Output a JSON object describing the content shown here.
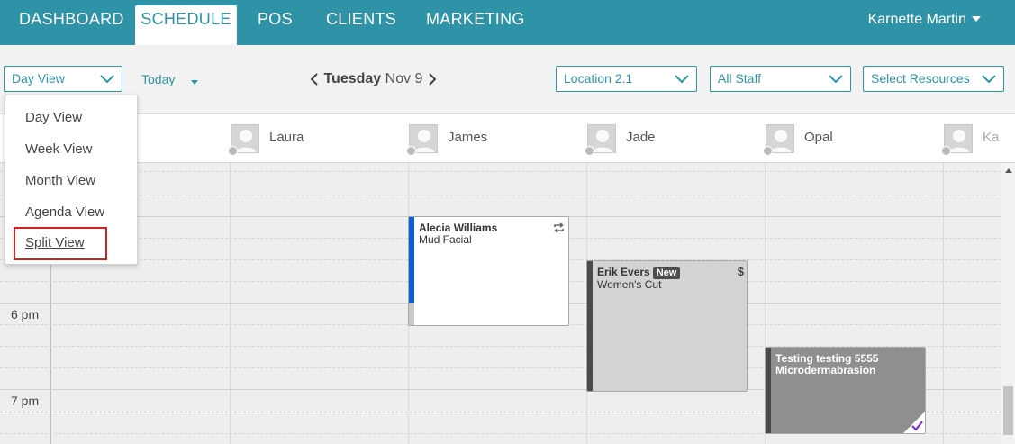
{
  "nav": {
    "items": [
      "DASHBOARD",
      "SCHEDULE",
      "POS",
      "CLIENTS",
      "MARKETING"
    ],
    "active": "SCHEDULE",
    "user": "Karnette Martin"
  },
  "toolbar": {
    "view_select": "Day View",
    "today": "Today",
    "date_day": "Tuesday",
    "date_rest": "Nov 9",
    "location": "Location 2.1",
    "staff": "All Staff",
    "resources": "Select Resources"
  },
  "view_menu": {
    "items": [
      "Day View",
      "Week View",
      "Month View",
      "Agenda View",
      "Split View"
    ]
  },
  "staff": [
    "Laura",
    "James",
    "Jade",
    "Opal",
    "Ka"
  ],
  "time_labels": [
    "6 pm",
    "7 pm"
  ],
  "appointments": [
    {
      "client": "Alecia Williams",
      "service": "Mud Facial",
      "icon": "repeat-icon",
      "color": "#0b5ed7"
    },
    {
      "client": "Erik Evers",
      "badge": "New",
      "service": "Women's Cut",
      "icon": "dollar-icon",
      "color": "#4a4a4a"
    },
    {
      "client": "Testing testing 5555",
      "service": "Microdermabrasion",
      "icon": "checkmark-icon",
      "color": "#4a4a4a"
    }
  ],
  "colors": {
    "nav_bg": "#2e93a6",
    "accent": "#2e93a6",
    "highlight_border": "#d42020",
    "check": "#7b2fd4"
  }
}
